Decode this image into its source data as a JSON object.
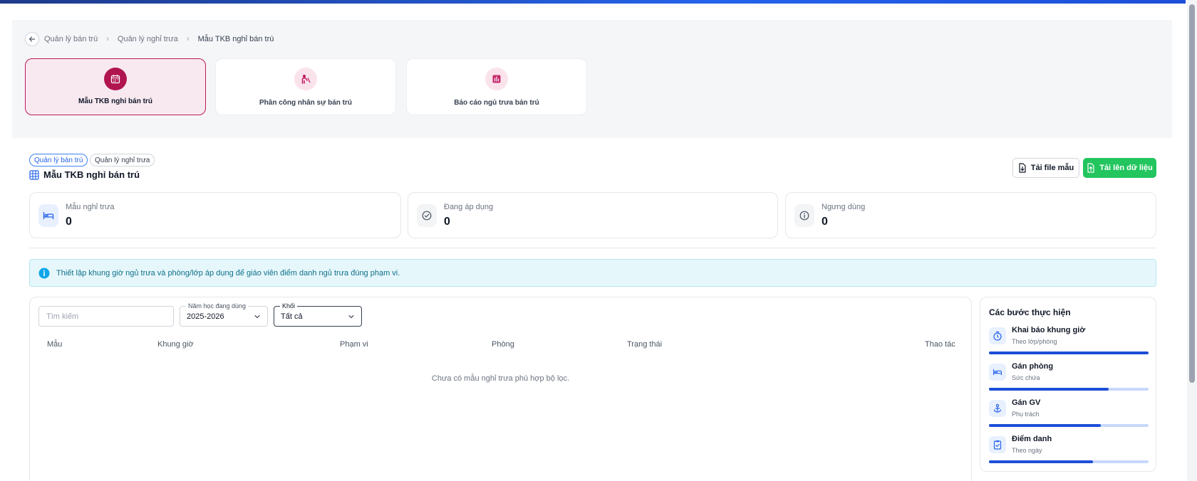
{
  "breadcrumb": {
    "items": [
      "Quản lý bán trú",
      "Quản lý nghỉ trưa",
      "Mẫu TKB nghỉ bán trú"
    ]
  },
  "modules": [
    {
      "label": "Mẫu TKB nghỉ bán trú",
      "icon": "calendar-icon",
      "active": true
    },
    {
      "label": "Phân công nhân sự bán trú",
      "icon": "teacher-icon",
      "active": false
    },
    {
      "label": "Báo cáo ngủ trưa bán trú",
      "icon": "report-icon",
      "active": false
    }
  ],
  "header": {
    "tags": [
      "Quản lý bán trú",
      "Quản lý nghỉ trưa"
    ],
    "title": "Mẫu TKB nghỉ bán trú",
    "download_template_label": "Tải file mẫu",
    "upload_label": "Tải lên dữ liệu"
  },
  "stats": [
    {
      "label": "Mẫu nghỉ trưa",
      "value": "0",
      "icon": "bed-icon"
    },
    {
      "label": "Đang áp dụng",
      "value": "0",
      "icon": "check-circle-icon"
    },
    {
      "label": "Ngưng dùng",
      "value": "0",
      "icon": "info-circle-icon"
    }
  ],
  "info_banner": {
    "text": "Thiết lập khung giờ ngủ trưa và phòng/lớp áp dụng để giáo viên điểm danh ngủ trưa đúng phạm vi."
  },
  "filters": {
    "search_placeholder": "Tìm kiếm",
    "school_year": {
      "label": "Năm học đang dùng",
      "value": "2025-2026"
    },
    "grade": {
      "label": "Khối",
      "value": "Tất cả"
    }
  },
  "table": {
    "columns": [
      "Mẫu",
      "Khung giờ",
      "Phạm vi",
      "Phòng",
      "Trạng thái",
      "Thao tác"
    ],
    "rows": [],
    "empty_message": "Chưa có mẫu nghỉ trưa phù hợp bộ lọc."
  },
  "steps": {
    "title": "Các bước thực hiện",
    "items": [
      {
        "name": "Khai báo khung giờ",
        "sub": "Theo lớp/phòng",
        "icon": "timer-icon",
        "progress": 1.0
      },
      {
        "name": "Gán phòng",
        "sub": "Sức chứa",
        "icon": "bed-icon",
        "progress": 0.75
      },
      {
        "name": "Gán GV",
        "sub": "Phụ trách",
        "icon": "anchor-icon",
        "progress": 0.7
      },
      {
        "name": "Điểm danh",
        "sub": "Theo ngày",
        "icon": "clipboard-check-icon",
        "progress": 0.65
      }
    ]
  },
  "colors": {
    "accent": "#b0154f",
    "primary": "#2563eb",
    "success": "#22c55e",
    "info": "#0ea5e9"
  }
}
